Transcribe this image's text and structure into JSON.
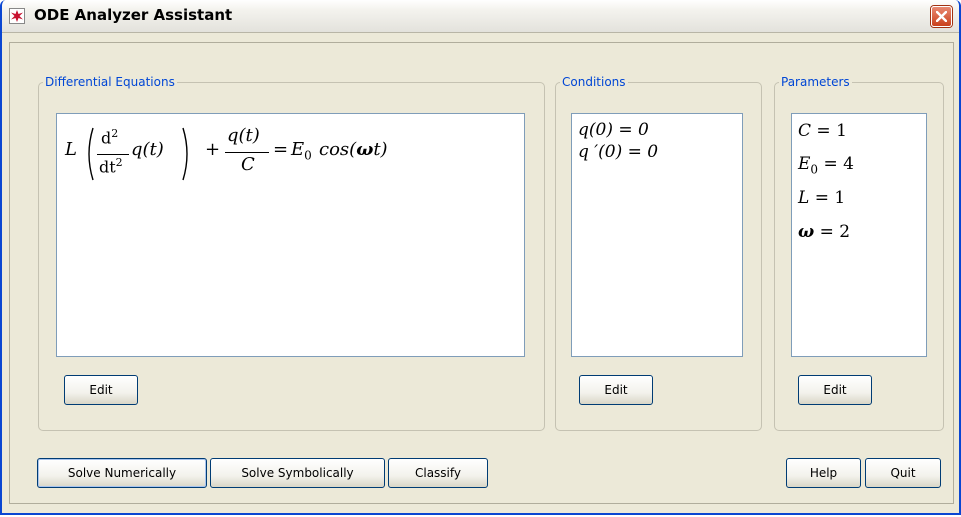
{
  "window": {
    "title": "ODE Analyzer Assistant"
  },
  "groups": {
    "equations": {
      "label": "Differential Equations"
    },
    "conditions": {
      "label": "Conditions"
    },
    "parameters": {
      "label": "Parameters"
    }
  },
  "equation": {
    "L": "L",
    "d_num": "d",
    "d_num_exp": "2",
    "d_den": "dt",
    "d_den_exp": "2",
    "q_t": "q(t)",
    "plus": "+",
    "frac_num": "q(t)",
    "frac_den": "C",
    "equals": "=",
    "E": "E",
    "E_sub": "0",
    "cos": "cos(",
    "omega": "ω",
    "t_close": "t)"
  },
  "conditions": {
    "items": [
      "q(0) = 0",
      "q ′(0) = 0"
    ]
  },
  "parameters": {
    "C_lhs": "C",
    "C_rhs": "= 1",
    "E_lhs": "E",
    "E_sub": "0",
    "E_rhs": "= 4",
    "L_lhs": "L",
    "L_rhs": "= 1",
    "omega_lhs": "ω",
    "omega_rhs": "= 2"
  },
  "buttons": {
    "edit_equations": "Edit",
    "edit_conditions": "Edit",
    "edit_parameters": "Edit",
    "solve_numerically": "Solve Numerically",
    "solve_symbolically": "Solve Symbolically",
    "classify": "Classify",
    "help": "Help",
    "quit": "Quit"
  },
  "colors": {
    "legend": "#0046d5",
    "window_bg": "#ece9d8",
    "close_button": "#d2522c",
    "box_border": "#7f9db9"
  }
}
